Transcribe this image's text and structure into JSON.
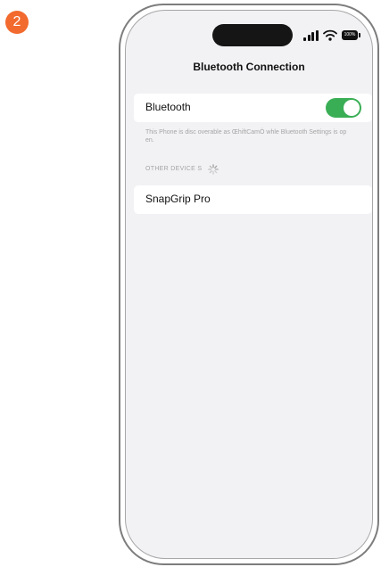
{
  "step_badge": "2",
  "status_bar": {
    "battery_text": "100%",
    "icons": [
      "signal-icon",
      "wifi-icon",
      "battery-icon"
    ]
  },
  "nav": {
    "title": "Bluetooth Connection"
  },
  "bluetooth": {
    "label": "Bluetooth",
    "enabled": true,
    "footnote": "This Phone is disc overable as ŒhiftCamÓ whle Bluetooth Settings is op en."
  },
  "other_devices": {
    "header": "OTHER DEVICE S",
    "loading_icon": "spinner-icon",
    "items": [
      {
        "name": "SnapGrip Pro"
      }
    ]
  },
  "colors": {
    "step_badge": "#f26a2e",
    "toggle_on": "#3aae55",
    "screen_background": "#f2f2f5",
    "secondary_text": "#a5a5a5"
  }
}
